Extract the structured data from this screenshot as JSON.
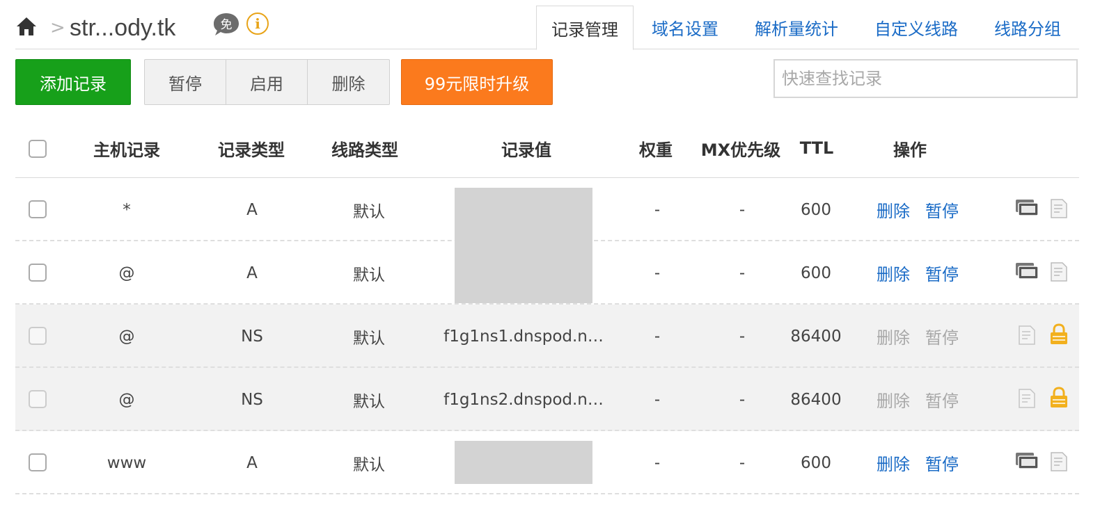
{
  "header": {
    "crumb_separator": ">",
    "domain": "str...ody.tk",
    "free_badge": "免",
    "info_symbol": "i"
  },
  "tabs": [
    {
      "label": "记录管理",
      "active": true
    },
    {
      "label": "域名设置",
      "active": false
    },
    {
      "label": "解析量统计",
      "active": false
    },
    {
      "label": "自定义线路",
      "active": false
    },
    {
      "label": "线路分组",
      "active": false
    }
  ],
  "toolbar": {
    "add_label": "添加记录",
    "pause_label": "暂停",
    "enable_label": "启用",
    "delete_label": "删除",
    "upgrade_label": "99元限时升级",
    "search_placeholder": "快速查找记录"
  },
  "columns": {
    "host": "主机记录",
    "type": "记录类型",
    "line": "线路类型",
    "value": "记录值",
    "weight": "权重",
    "mx": "MX优先级",
    "ttl": "TTL",
    "ops": "操作"
  },
  "rows": [
    {
      "host": "*",
      "type": "A",
      "line": "默认",
      "value": "",
      "weight": "-",
      "mx": "-",
      "ttl": "600",
      "delete": "删除",
      "pause": "暂停"
    },
    {
      "host": "@",
      "type": "A",
      "line": "默认",
      "value": "",
      "weight": "-",
      "mx": "-",
      "ttl": "600",
      "delete": "删除",
      "pause": "暂停"
    },
    {
      "host": "@",
      "type": "NS",
      "line": "默认",
      "value": "f1g1ns1.dnspod.n…",
      "weight": "-",
      "mx": "-",
      "ttl": "86400",
      "delete": "删除",
      "pause": "暂停"
    },
    {
      "host": "@",
      "type": "NS",
      "line": "默认",
      "value": "f1g1ns2.dnspod.n…",
      "weight": "-",
      "mx": "-",
      "ttl": "86400",
      "delete": "删除",
      "pause": "暂停"
    },
    {
      "host": "www",
      "type": "A",
      "line": "默认",
      "value": "",
      "weight": "-",
      "mx": "-",
      "ttl": "600",
      "delete": "删除",
      "pause": "暂停"
    }
  ],
  "colors": {
    "primary_green": "#17a01a",
    "upgrade_orange": "#fb7a1d",
    "link_blue": "#1a6bc6",
    "disabled_gray": "#a8a8a8",
    "lock_gold": "#f2b01e"
  }
}
